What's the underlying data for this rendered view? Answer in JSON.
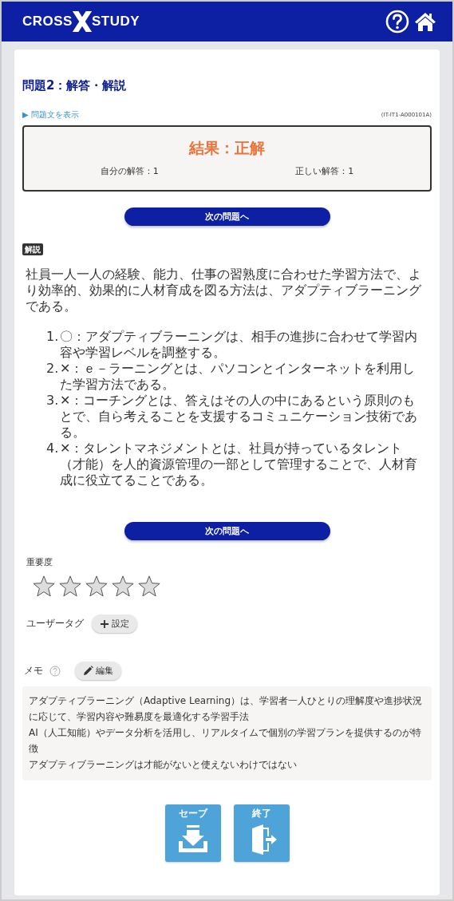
{
  "header": {
    "logo_left": "CROSS",
    "logo_right": "STUDY"
  },
  "title": "問題2：解答・解説",
  "show_question_link": "▶ 問題文を表示",
  "question_code": "(IT-IT1-A000101A)",
  "result": {
    "heading": "結果：正解",
    "my_answer": "自分の解答：1",
    "correct_answer": "正しい解答：1"
  },
  "next_button_top": "次の問題へ",
  "explanation_label": "解説",
  "explanation": "社員一人一人の経験、能力、仕事の習熟度に合わせた学習方法で、より効率的、効果的に人材育成を図る方法は、アダプティブラーニングである。",
  "choices": [
    {
      "number": "1.",
      "text": "〇：アダプティブラーニングは、相手の進捗に合わせて学習内容や学習レベルを調整する。"
    },
    {
      "number": "2.",
      "text": "✕：ｅ－ラーニングとは、パソコンとインターネットを利用した学習方法である。"
    },
    {
      "number": "3.",
      "text": "✕：コーチングとは、答えはその人の中にあるという原則のもとで、自ら考えることを支援するコミュニケーション技術である。"
    },
    {
      "number": "4.",
      "text": "✕：タレントマネジメントとは、社員が持っているタレント（才能）を人的資源管理の一部として管理することで、人材育成に役立てることである。"
    }
  ],
  "next_button_bottom": "次の問題へ",
  "importance": {
    "label": "重要度",
    "stars": 0
  },
  "user_tag": {
    "label": "ユーザータグ",
    "button": "設定"
  },
  "memo": {
    "label": "メモ",
    "button": "編集",
    "lines": [
      "アダプティブラーニング（Adaptive Learning）は、学習者一人ひとりの理解度や進捗状況に応じて、学習内容や難易度を最適化する学習手法",
      "AI（人工知能）やデータ分析を活用し、リアルタイムで個別の学習プランを提供するのが特徴",
      "アダプティブラーニングは才能がないと使えないわけではない"
    ]
  },
  "actions": [
    {
      "kind": "save",
      "label": "セーブ"
    },
    {
      "kind": "exit",
      "label": "終了"
    }
  ]
}
